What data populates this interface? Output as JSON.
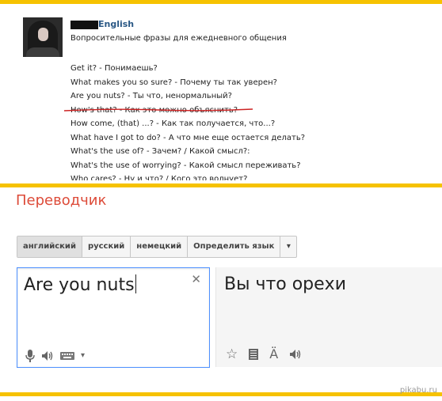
{
  "post": {
    "author": "English",
    "subtitle": "Вопросительные фразы для ежедневного общения",
    "phrases": [
      "Get it? - Понимаешь?",
      "What makes you so sure? - Почему ты так уверен?",
      "Are you nuts? - Ты что, ненормальный?",
      "How's that? - Как это можно объяснить?",
      "How come, (that) ...? - Как так получается, что...?",
      "What have I got to do? - А что мне еще остается делать?",
      "What's the use of? - Зачем? / Какой смысл?:",
      "What's the use of worrying? - Какой смысл переживать?",
      "Who cares? - Ну и что? / Кого это волнует?"
    ]
  },
  "translator": {
    "title": "Переводчик",
    "tabs": [
      "английский",
      "русский",
      "немецкий",
      "Определить язык"
    ],
    "active_tab": "английский",
    "source_text": "Are you nuts",
    "translation": "Вы что орехи"
  },
  "watermark": "pikabu.ru",
  "colors": {
    "accent_bar": "#f6c200",
    "title_red": "#dd4b39",
    "input_focus": "#4d90fe",
    "underline_red": "#cc2222"
  }
}
